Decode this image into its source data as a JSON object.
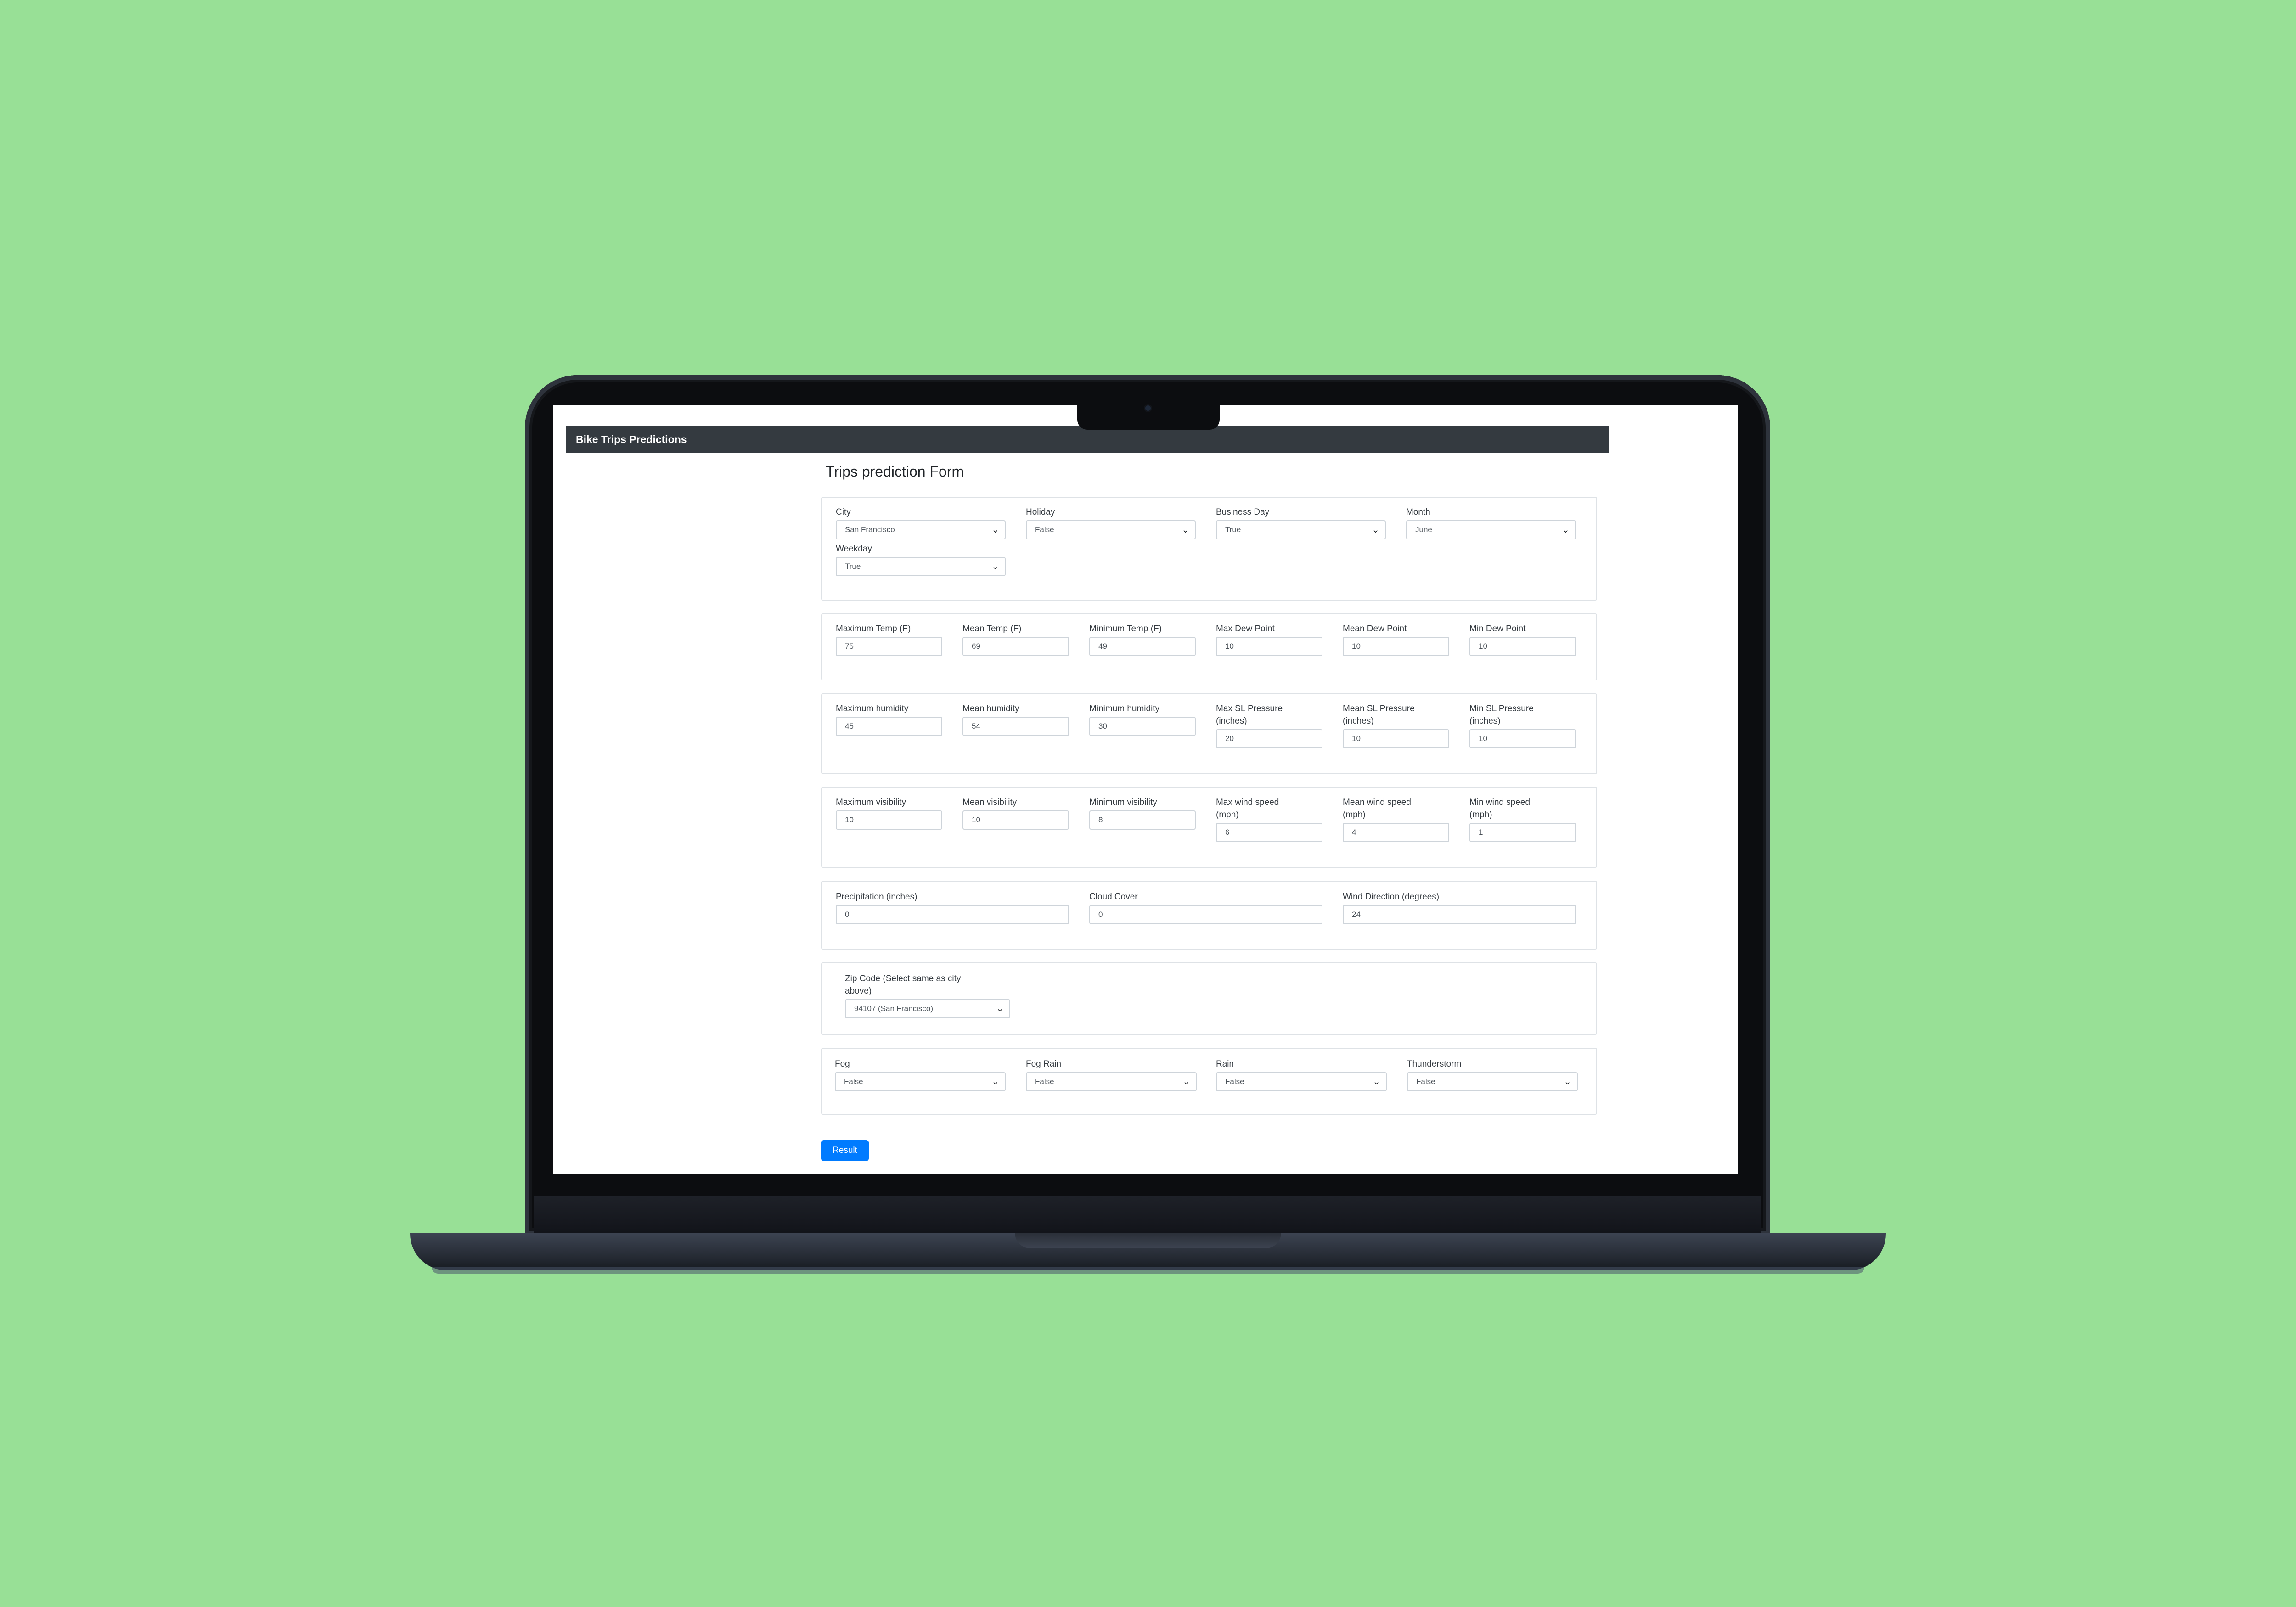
{
  "app": {
    "brand": "Bike Trips Predictions",
    "form_title": "Trips prediction Form"
  },
  "section1": {
    "city": {
      "label": "City",
      "value": "San Francisco"
    },
    "holiday": {
      "label": "Holiday",
      "value": "False"
    },
    "business_day": {
      "label": "Business Day",
      "value": "True"
    },
    "month": {
      "label": "Month",
      "value": "June"
    },
    "weekday": {
      "label": "Weekday",
      "value": "True"
    }
  },
  "section2": {
    "max_temp": {
      "label": "Maximum Temp (F)",
      "value": "75"
    },
    "mean_temp": {
      "label": "Mean Temp (F)",
      "value": "69"
    },
    "min_temp": {
      "label": "Minimum Temp (F)",
      "value": "49"
    },
    "max_dew": {
      "label": "Max Dew Point",
      "value": "10"
    },
    "mean_dew": {
      "label": "Mean Dew Point",
      "value": "10"
    },
    "min_dew": {
      "label": "Min Dew Point",
      "value": "10"
    }
  },
  "section3": {
    "max_humidity": {
      "label": "Maximum humidity",
      "value": "45"
    },
    "mean_humidity": {
      "label": "Mean humidity",
      "value": "54"
    },
    "min_humidity": {
      "label": "Minimum humidity",
      "value": "30"
    },
    "max_pressure": {
      "label1": "Max SL Pressure",
      "label2": "(inches)",
      "value": "20"
    },
    "mean_pressure": {
      "label1": "Mean SL Pressure",
      "label2": "(inches)",
      "value": "10"
    },
    "min_pressure": {
      "label1": "Min SL Pressure",
      "label2": "(inches)",
      "value": "10"
    }
  },
  "section4": {
    "max_visibility": {
      "label": "Maximum visibility",
      "value": "10"
    },
    "mean_visibility": {
      "label": "Mean visibility",
      "value": "10"
    },
    "min_visibility": {
      "label": "Minimum visibility",
      "value": "8"
    },
    "max_wind": {
      "label1": "Max wind speed",
      "label2": "(mph)",
      "value": "6"
    },
    "mean_wind": {
      "label1": "Mean wind speed",
      "label2": "(mph)",
      "value": "4"
    },
    "min_wind": {
      "label1": "Min wind speed",
      "label2": "(mph)",
      "value": "1"
    }
  },
  "section5": {
    "precipitation": {
      "label": "Precipitation (inches)",
      "value": "0"
    },
    "cloud_cover": {
      "label": "Cloud Cover",
      "value": "0"
    },
    "wind_direction": {
      "label": "Wind Direction (degrees)",
      "value": "24"
    }
  },
  "section6": {
    "zip": {
      "label1": "Zip Code (Select same as city",
      "label2": "above)",
      "value": "94107 (San Francisco)"
    }
  },
  "section7": {
    "fog": {
      "label": "Fog",
      "value": "False"
    },
    "fog_rain": {
      "label": "Fog Rain",
      "value": "False"
    },
    "rain": {
      "label": "Rain",
      "value": "False"
    },
    "thunderstorm": {
      "label": "Thunderstorm",
      "value": "False"
    }
  },
  "submit": {
    "label": "Result"
  },
  "icons": {
    "select_arrow": "chevron-down-icon"
  },
  "colors": {
    "background": "#98e096",
    "navbar": "#343a40",
    "primary": "#007bff"
  }
}
